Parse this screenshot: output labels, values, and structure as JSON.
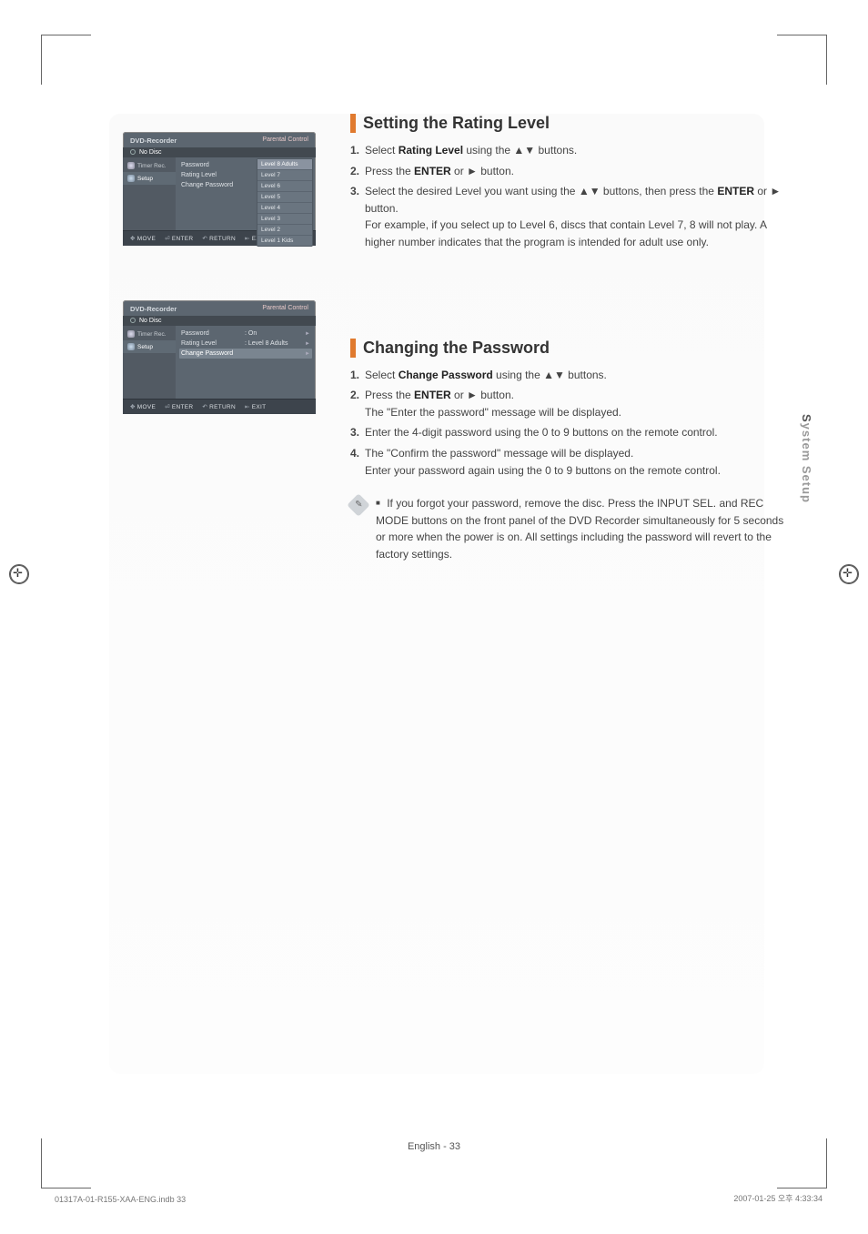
{
  "osd1": {
    "title_left": "DVD-Recorder",
    "title_right": "Parental Control",
    "nodisc": "No Disc",
    "sidebar": [
      {
        "label": "Timer Rec."
      },
      {
        "label": "Setup"
      }
    ],
    "rows": [
      {
        "label": "Password",
        "value": ""
      },
      {
        "label": "Rating Level",
        "value": ""
      },
      {
        "label": "Change Password",
        "value": ""
      }
    ],
    "dropdown": [
      "Level  8 Adults",
      "Level  7",
      "Level  6",
      "Level  5",
      "Level  4",
      "Level  3",
      "Level  2",
      "Level  1 Kids"
    ],
    "footer": {
      "move": "MOVE",
      "enter": "ENTER",
      "return": "RETURN",
      "exit": "EXIT"
    }
  },
  "osd2": {
    "title_left": "DVD-Recorder",
    "title_right": "Parental Control",
    "nodisc": "No Disc",
    "sidebar": [
      {
        "label": "Timer Rec."
      },
      {
        "label": "Setup"
      }
    ],
    "rows": [
      {
        "label": "Password",
        "value": ": On"
      },
      {
        "label": "Rating Level",
        "value": ": Level 8 Adults"
      },
      {
        "label": "Change Password",
        "value": ""
      }
    ],
    "footer": {
      "move": "MOVE",
      "enter": "ENTER",
      "return": "RETURN",
      "exit": "EXIT"
    }
  },
  "section1": {
    "title": "Setting the Rating Level",
    "steps": {
      "s1a": "Select ",
      "s1b": "Rating Level",
      "s1c": " using the ▲▼ buttons.",
      "s2a": "Press the ",
      "s2b": "ENTER",
      "s2c": " or ► button.",
      "s3a": "Select the desired Level you want using the ▲▼ buttons, then press the ",
      "s3b": "ENTER",
      "s3c": " or ► button.",
      "s3d": "For example, if you select up to Level 6, discs that contain Level 7, 8 will not play. A higher number indicates that the program is intended for adult use only."
    }
  },
  "section2": {
    "title": "Changing the Password",
    "steps": {
      "s1a": "Select ",
      "s1b": "Change Password",
      "s1c": " using the ▲▼ buttons.",
      "s2a": "Press the ",
      "s2b": "ENTER",
      "s2c": " or ► button.",
      "s2d": "The \"Enter the password\" message will be displayed.",
      "s3": "Enter the 4-digit password using the 0 to 9 buttons on the remote control.",
      "s4a": "The \"Confirm the password\" message will be displayed.",
      "s4b": "Enter your password again using the 0 to 9 buttons on the remote control."
    },
    "note_pre": "If you forgot your password, remove the disc. Press the ",
    "note_b1": "INPUT SEL.",
    "note_mid": " and ",
    "note_b2": "REC MODE",
    "note_post": " buttons on the front panel of the DVD Recorder simultaneously for 5 seconds or more when the power is on. All settings including the password will revert to the factory settings."
  },
  "side_tab": {
    "accent": "S",
    "rest": "ystem Setup"
  },
  "page_num": "English - 33",
  "foot_left": "01317A-01-R155-XAA-ENG.indb   33",
  "foot_right": "2007-01-25   오후 4:33:34"
}
